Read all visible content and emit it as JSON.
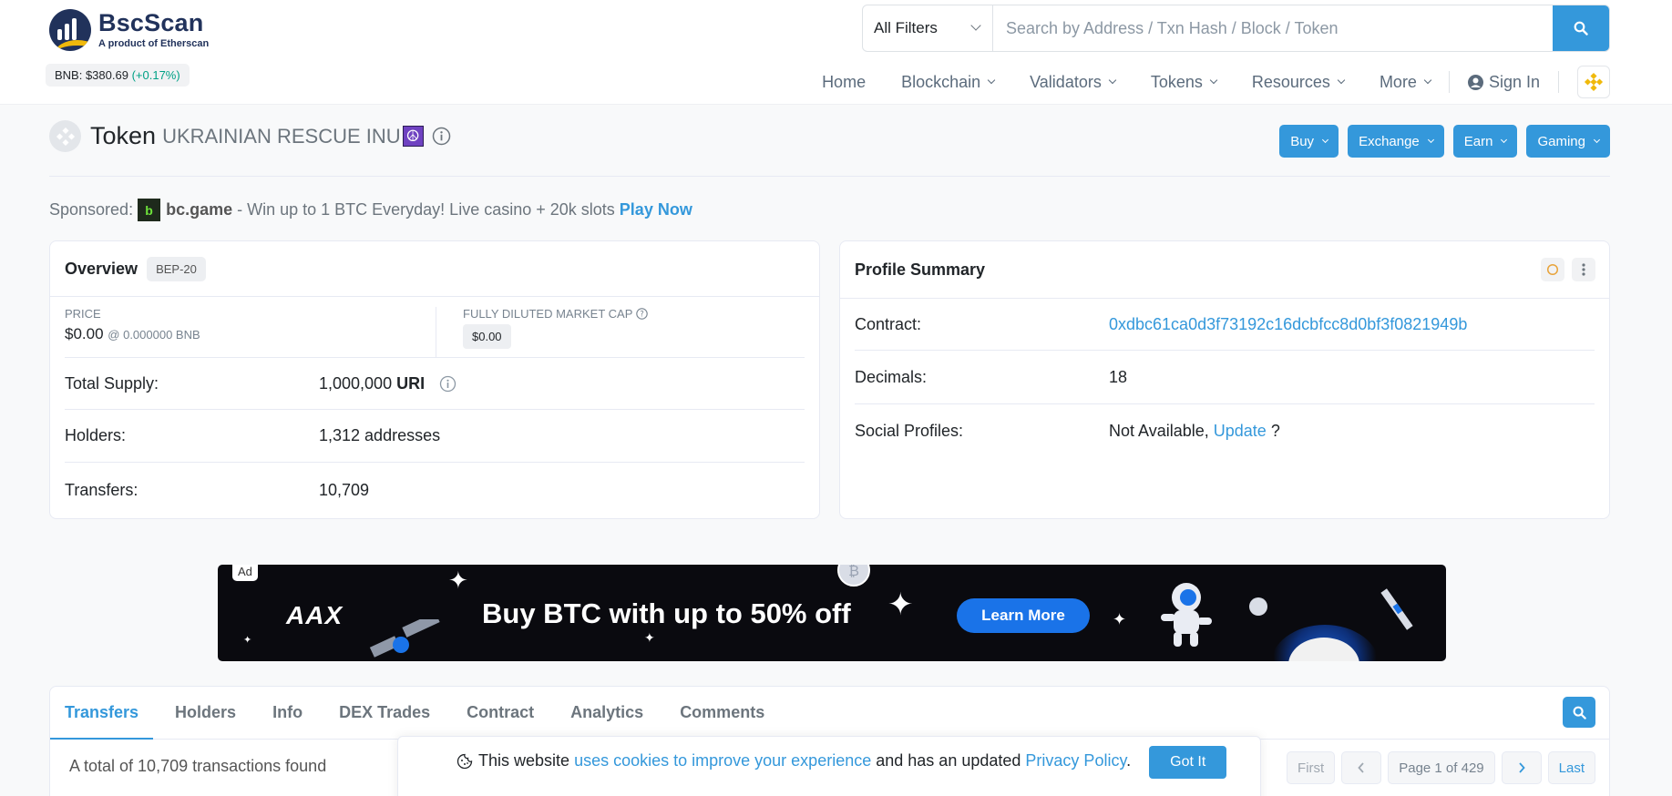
{
  "header": {
    "brand": "BscScan",
    "brand_sub": "A product of Etherscan",
    "bnb_price_label": "BNB: $380.69",
    "bnb_change": "(+0.17%)",
    "filter_label": "All Filters",
    "search_placeholder": "Search by Address / Txn Hash / Block / Token",
    "nav": [
      "Home",
      "Blockchain",
      "Validators",
      "Tokens",
      "Resources",
      "More"
    ],
    "sign_in": "Sign In"
  },
  "token": {
    "label": "Token",
    "name": "UKRAINIAN RESCUE INU",
    "emoji": "☮",
    "actions": [
      "Buy",
      "Exchange",
      "Earn",
      "Gaming"
    ]
  },
  "sponsored": {
    "prefix": "Sponsored:",
    "logo_letter": "b",
    "name": "bc.game",
    "text": "- Win up to 1 BTC Everyday! Live casino + 20k slots",
    "cta": "Play Now"
  },
  "overview": {
    "title": "Overview",
    "badge": "BEP-20",
    "price_label": "PRICE",
    "price_value": "$0.00",
    "price_bnb": "@ 0.000000 BNB",
    "mcap_label": "FULLY DILUTED MARKET CAP",
    "mcap_value": "$0.00",
    "rows": [
      {
        "label": "Total Supply:",
        "value": "1,000,000",
        "unit": "URI"
      },
      {
        "label": "Holders:",
        "value": "1,312 addresses"
      },
      {
        "label": "Transfers:",
        "value": "10,709"
      }
    ]
  },
  "profile": {
    "title": "Profile Summary",
    "contract_label": "Contract:",
    "contract_value": "0xdbc61ca0d3f73192c16dcbfcc8d0bf3f0821949b",
    "decimals_label": "Decimals:",
    "decimals_value": "18",
    "social_label": "Social Profiles:",
    "social_value": "Not Available,",
    "social_link": "Update",
    "social_q": "?"
  },
  "ad": {
    "tag": "Ad",
    "brand": "AAX",
    "text": "Buy BTC with up to 50% off",
    "cta": "Learn More"
  },
  "tabs": {
    "items": [
      "Transfers",
      "Holders",
      "Info",
      "DEX Trades",
      "Contract",
      "Analytics",
      "Comments"
    ],
    "active": "Transfers",
    "total_text": "A total of 10,709 transactions found",
    "pager": {
      "first": "First",
      "page": "Page 1 of 429",
      "last": "Last"
    }
  },
  "cookie": {
    "text1": "This website",
    "link1": "uses cookies to improve your experience",
    "text2": "and has an updated",
    "link2": "Privacy Policy",
    "text3": ".",
    "button": "Got It"
  },
  "colors": {
    "accent": "#3498db",
    "positive": "#00a186",
    "brand": "#21325b",
    "bnb": "#f0b90b"
  }
}
